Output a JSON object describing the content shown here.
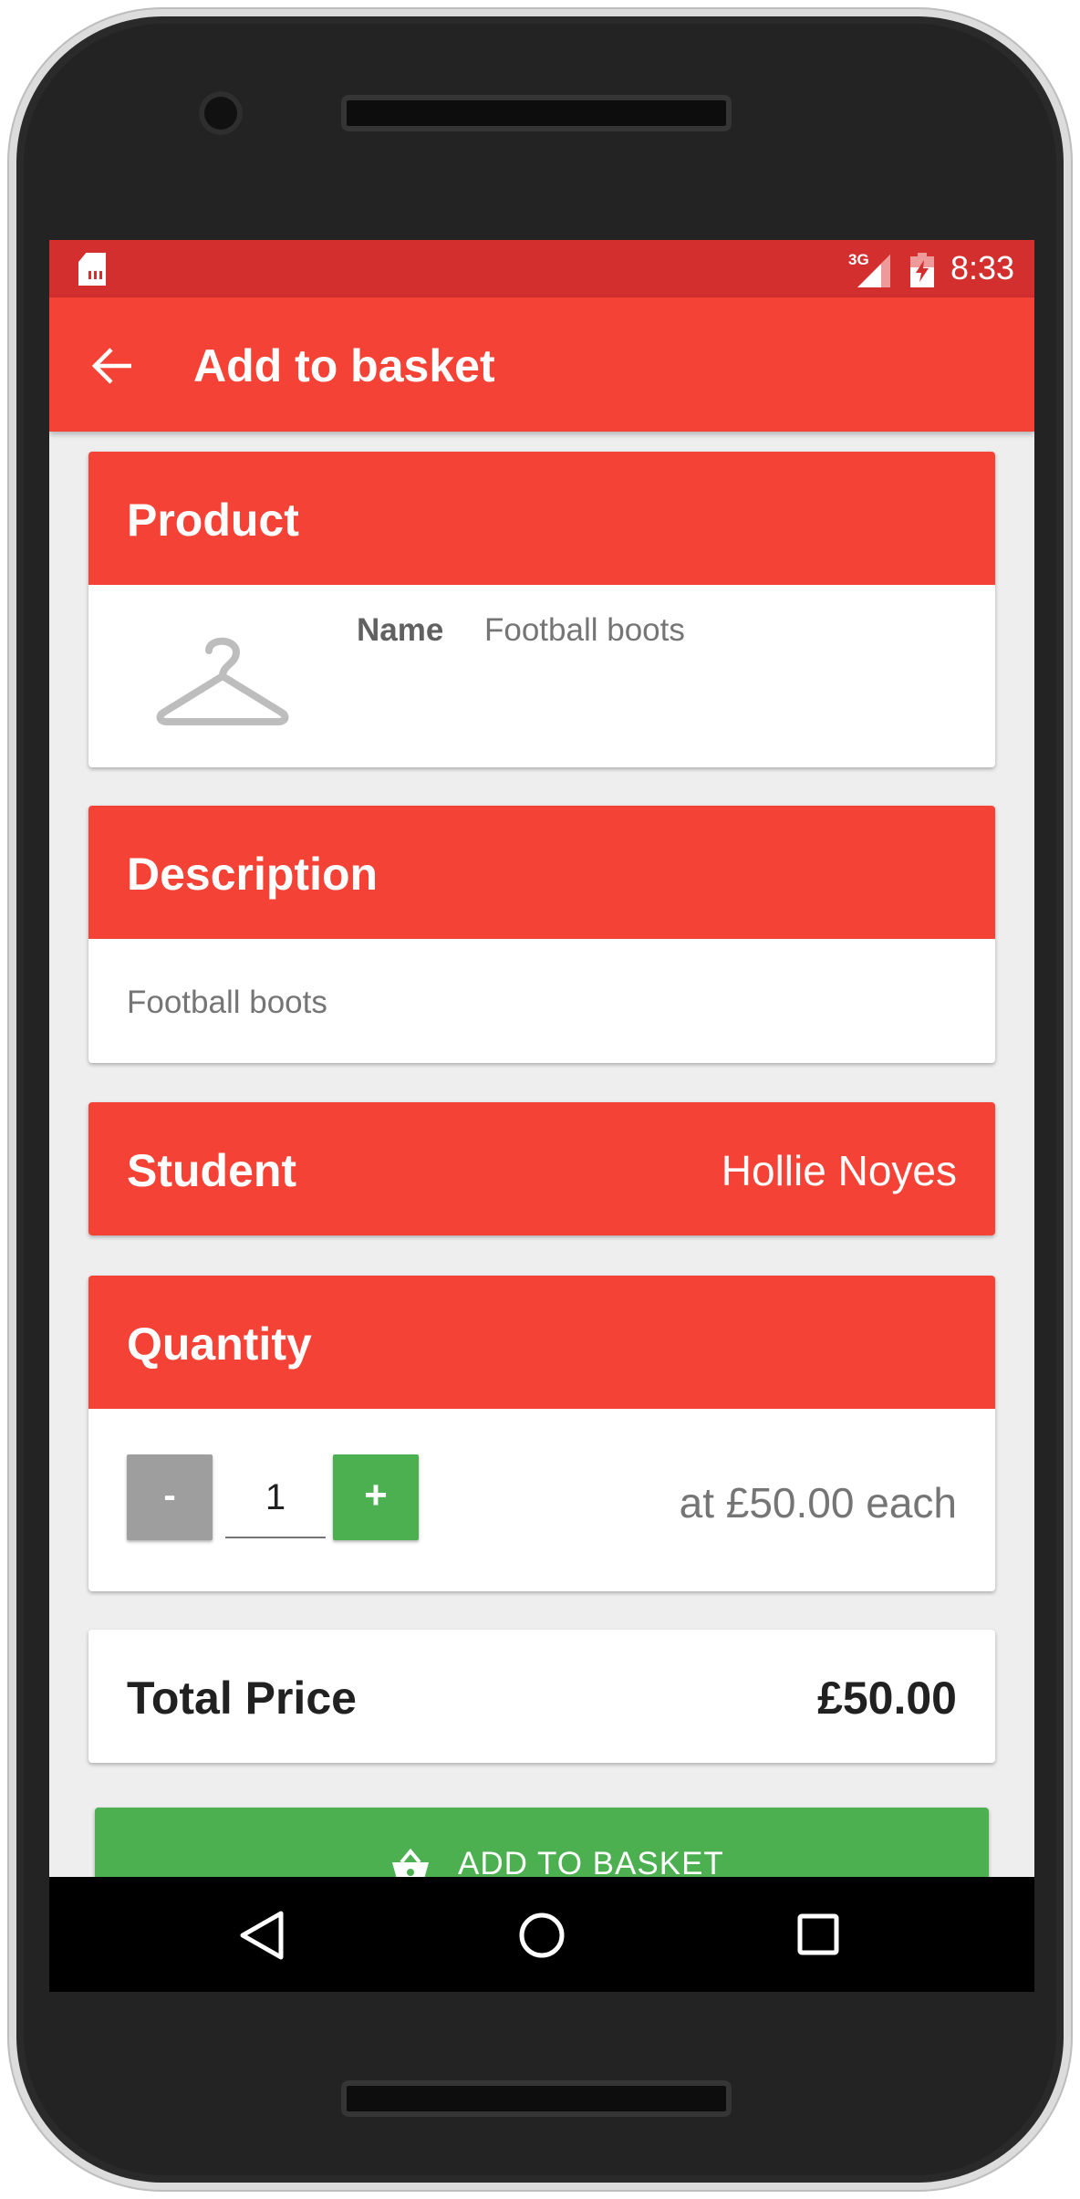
{
  "status_bar": {
    "network": "3G",
    "time": "8:33",
    "icons": [
      "sd-card-icon",
      "signal-icon",
      "battery-icon"
    ]
  },
  "app_bar": {
    "title": "Add to basket",
    "back_icon": "arrow-left-icon"
  },
  "product": {
    "header": "Product",
    "image_icon": "hanger-icon",
    "name_label": "Name",
    "name_value": "Football boots"
  },
  "description": {
    "header": "Description",
    "text": "Football boots"
  },
  "student": {
    "header": "Student",
    "name": "Hollie Noyes"
  },
  "quantity": {
    "header": "Quantity",
    "minus_label": "-",
    "plus_label": "+",
    "value": "1",
    "unit_price_text": "at £50.00 each"
  },
  "total": {
    "label": "Total Price",
    "value": "£50.00"
  },
  "add_button": {
    "label": "ADD TO BASKET",
    "icon": "basket-icon"
  },
  "nav_bar": {
    "icons": [
      "nav-back-icon",
      "nav-home-icon",
      "nav-recent-icon"
    ]
  },
  "colors": {
    "primary": "#f44336",
    "primary_dark": "#d32f2f",
    "accent_green": "#4caf50",
    "minus_grey": "#9e9e9e"
  }
}
